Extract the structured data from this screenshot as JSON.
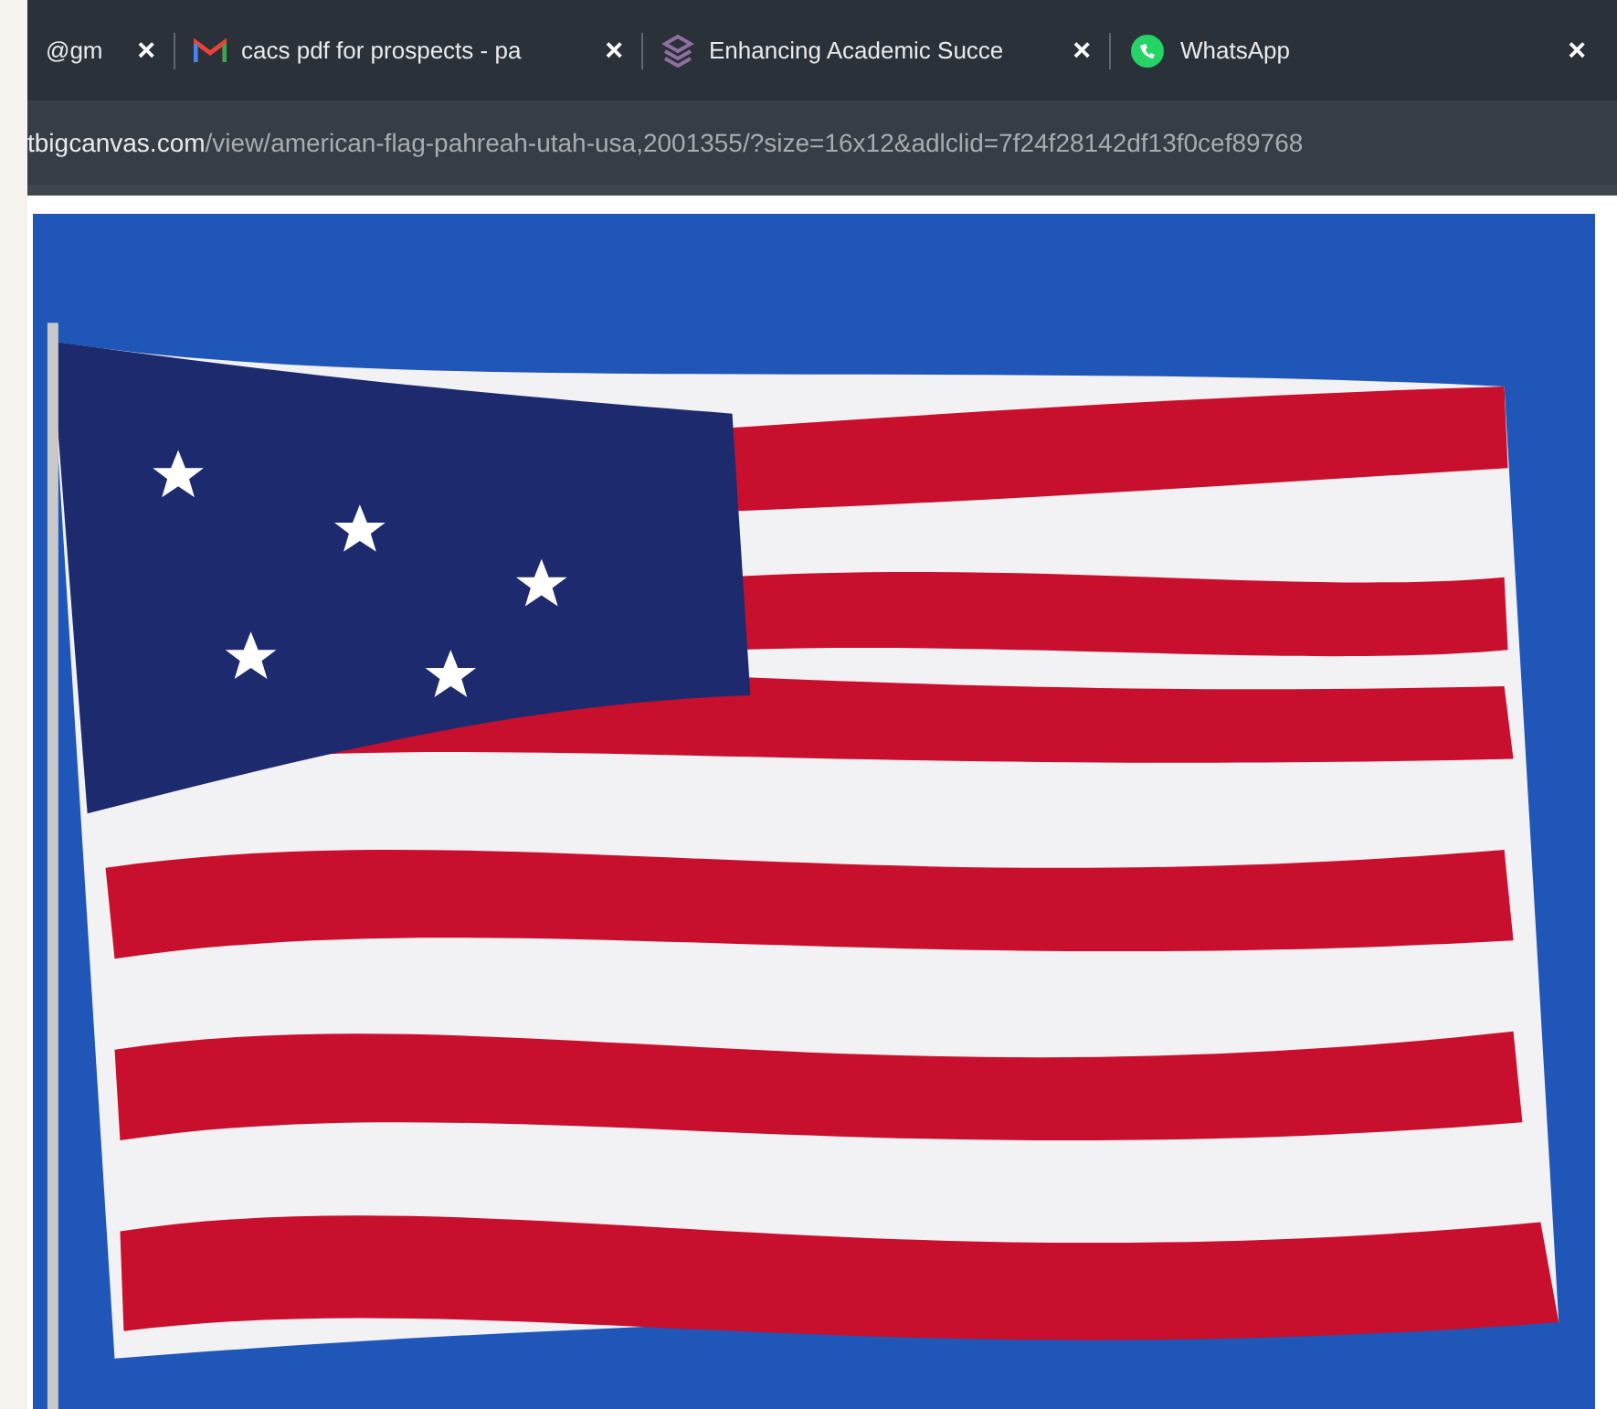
{
  "tabs": [
    {
      "kind": "plain",
      "title": "@gm",
      "close": "×"
    },
    {
      "kind": "mail",
      "title": "cacs pdf for prospects - pa",
      "close": "×"
    },
    {
      "kind": "layers",
      "title": "Enhancing Academic Succe",
      "close": "×"
    },
    {
      "kind": "chat",
      "title": "WhatsApp",
      "close": "×"
    }
  ],
  "address_bar": {
    "domain": "tbigcanvas.com",
    "path": "/view/american-flag-pahreah-utah-usa,2001355/?size=16x12&adlclid=7f24f28142df13f0cef89768"
  }
}
